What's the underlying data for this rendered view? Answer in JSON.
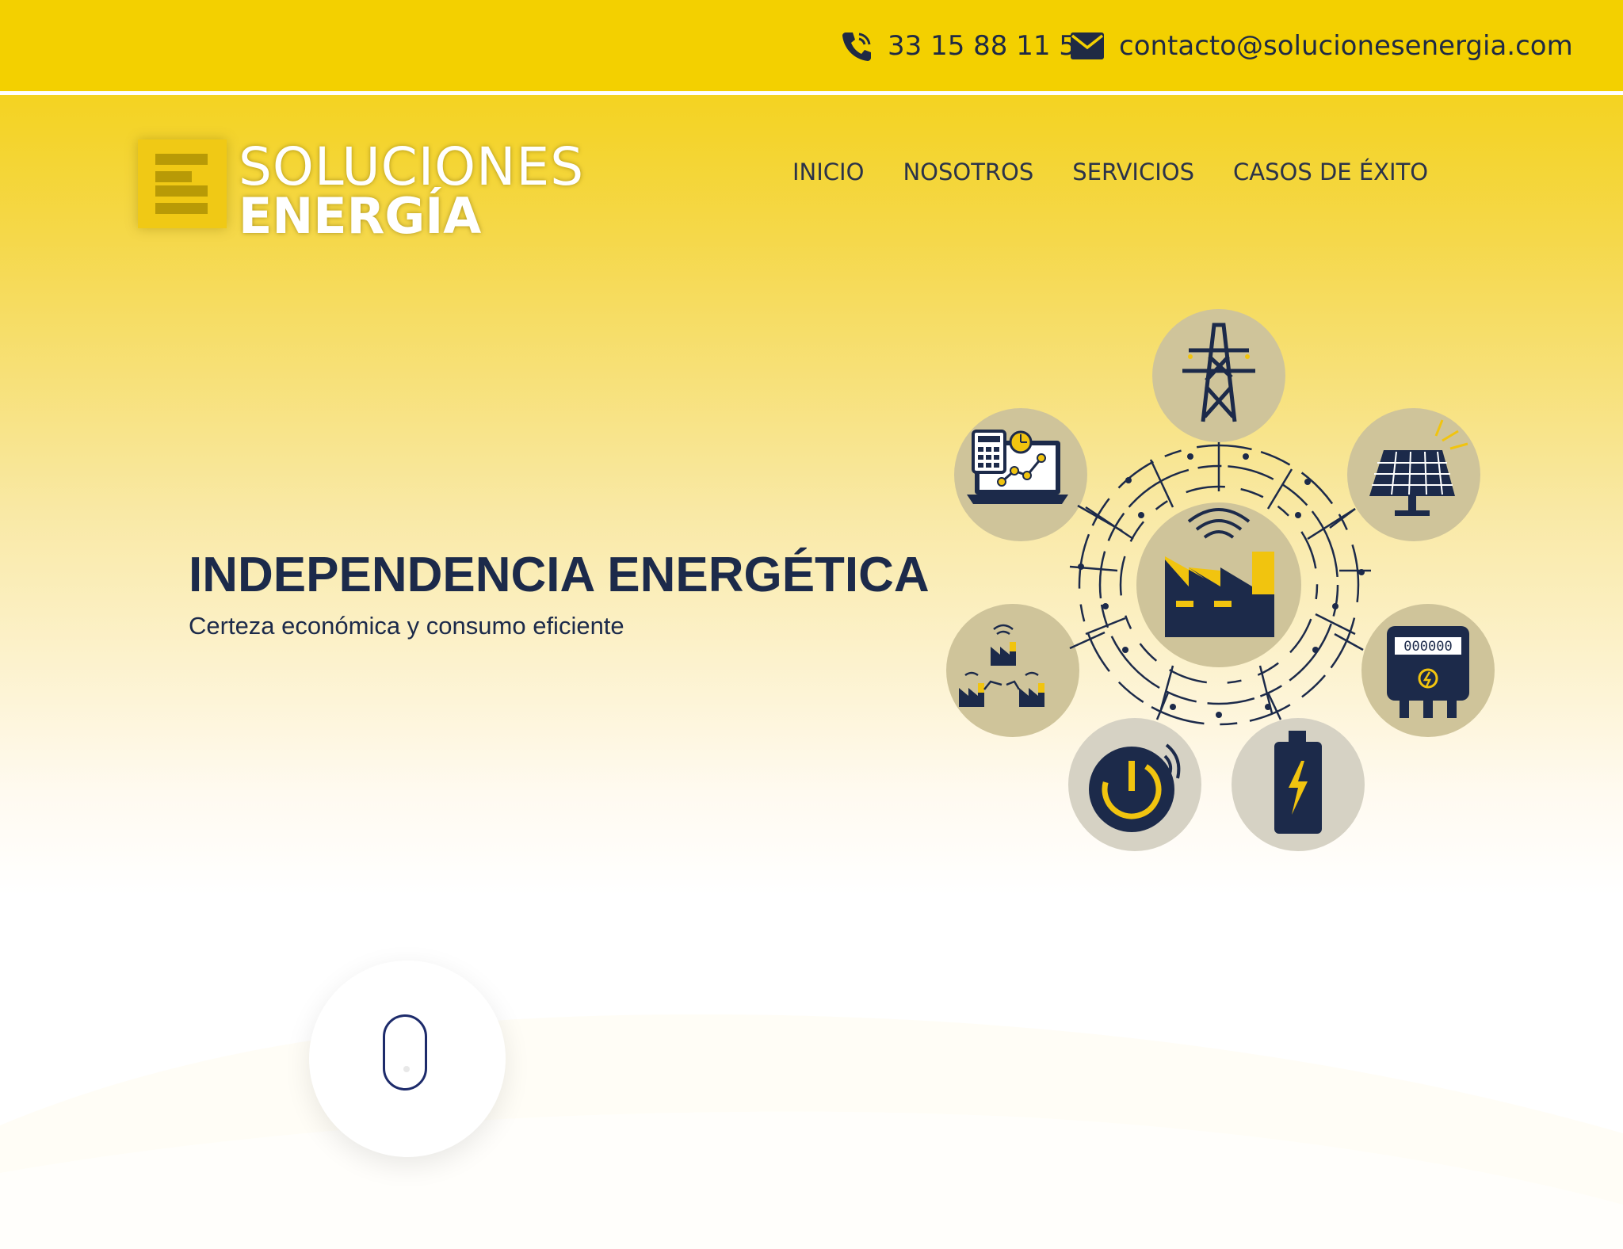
{
  "contact": {
    "phone": "33 15 88 11 53",
    "email": "contacto@solucionesenergia.com",
    "phone_icon": "phone-icon",
    "email_icon": "envelope-icon"
  },
  "logo": {
    "line1": "SOLUCIONES",
    "line2": "ENERGÍA"
  },
  "nav": {
    "items": [
      {
        "label": "INICIO"
      },
      {
        "label": "NOSOTROS"
      },
      {
        "label": "SERVICIOS"
      },
      {
        "label": "CASOS DE ÉXITO"
      }
    ]
  },
  "hero": {
    "title": "INDEPENDENCIA ENERGÉTICA",
    "subtitle": "Certeza económica y consumo eficiente"
  },
  "illustration": {
    "center_icon": "smart-factory-icon",
    "nodes": [
      "transmission-tower-icon",
      "solar-panel-icon",
      "energy-meter-icon",
      "battery-icon",
      "power-button-icon",
      "factories-network-icon",
      "analytics-laptop-icon"
    ],
    "meter_digits": "000000"
  },
  "scroll": {
    "icon": "mouse-scroll-icon"
  },
  "colors": {
    "brand_yellow": "#f3d000",
    "navy": "#1c2a4a",
    "circle_bg": "#cfc49a",
    "accent_yellow": "#f1c40f"
  }
}
